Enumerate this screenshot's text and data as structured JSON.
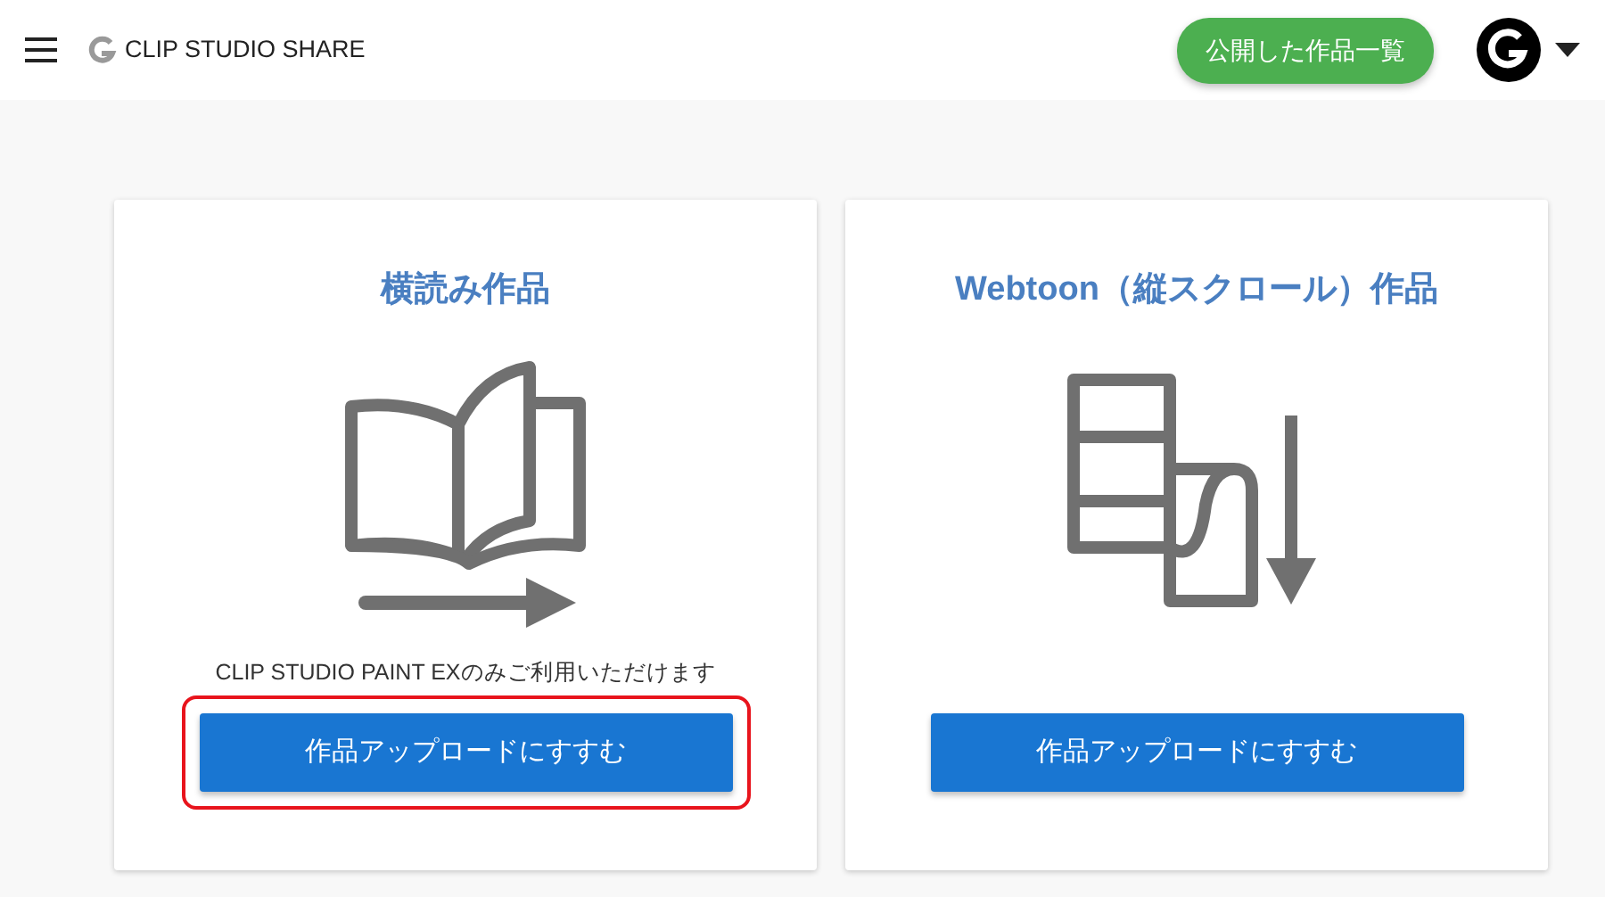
{
  "header": {
    "brand": "CLIP STUDIO SHARE",
    "published_button": "公開した作品一覧"
  },
  "cards": [
    {
      "title": "横読み作品",
      "kind": "book",
      "note": "CLIP STUDIO PAINT EXのみご利用いただけます",
      "button": "作品アップロードにすすむ",
      "highlighted": true
    },
    {
      "title": "Webtoon（縦スクロール）作品",
      "kind": "scroll",
      "button": "作品アップロードにすすむ",
      "highlighted": false
    }
  ]
}
